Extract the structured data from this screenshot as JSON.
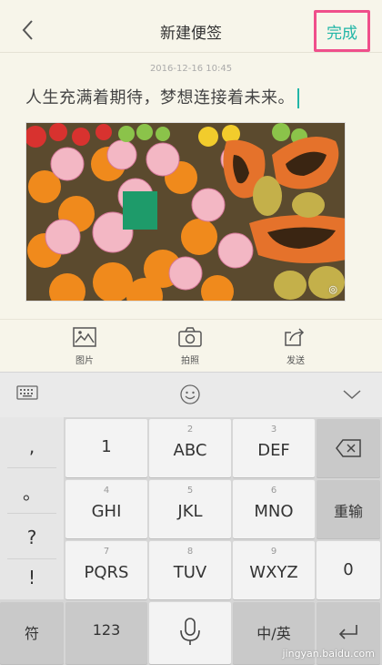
{
  "nav": {
    "back_icon": "chevron-left-icon",
    "title": "新建便签",
    "done": "完成"
  },
  "note": {
    "timestamp": "2016-12-16 10:45",
    "text": "人生充满着期待，梦想连接着未来。"
  },
  "attach": [
    {
      "label": "图片",
      "icon": "image-icon"
    },
    {
      "label": "拍照",
      "icon": "camera-icon"
    },
    {
      "label": "发送",
      "icon": "share-icon"
    }
  ],
  "toolbar": {
    "keyboard_icon": "keyboard-icon",
    "emoji_icon": "smiley-icon",
    "collapse_icon": "chevron-down-icon"
  },
  "keyboard": {
    "symbols": [
      ",",
      "。",
      "?",
      "!"
    ],
    "keys": [
      {
        "num": "",
        "main": "1"
      },
      {
        "num": "2",
        "main": "ABC"
      },
      {
        "num": "3",
        "main": "DEF"
      },
      {
        "num": "4",
        "main": "GHI"
      },
      {
        "num": "5",
        "main": "JKL"
      },
      {
        "num": "6",
        "main": "MNO"
      },
      {
        "num": "7",
        "main": "PQRS"
      },
      {
        "num": "8",
        "main": "TUV"
      },
      {
        "num": "9",
        "main": "WXYZ"
      }
    ],
    "reinput": "重输",
    "zero": "0",
    "symbol_key": "符",
    "num_key": "123",
    "lang_key": "中/英"
  },
  "watermark": "jingyan.baidu.com"
}
